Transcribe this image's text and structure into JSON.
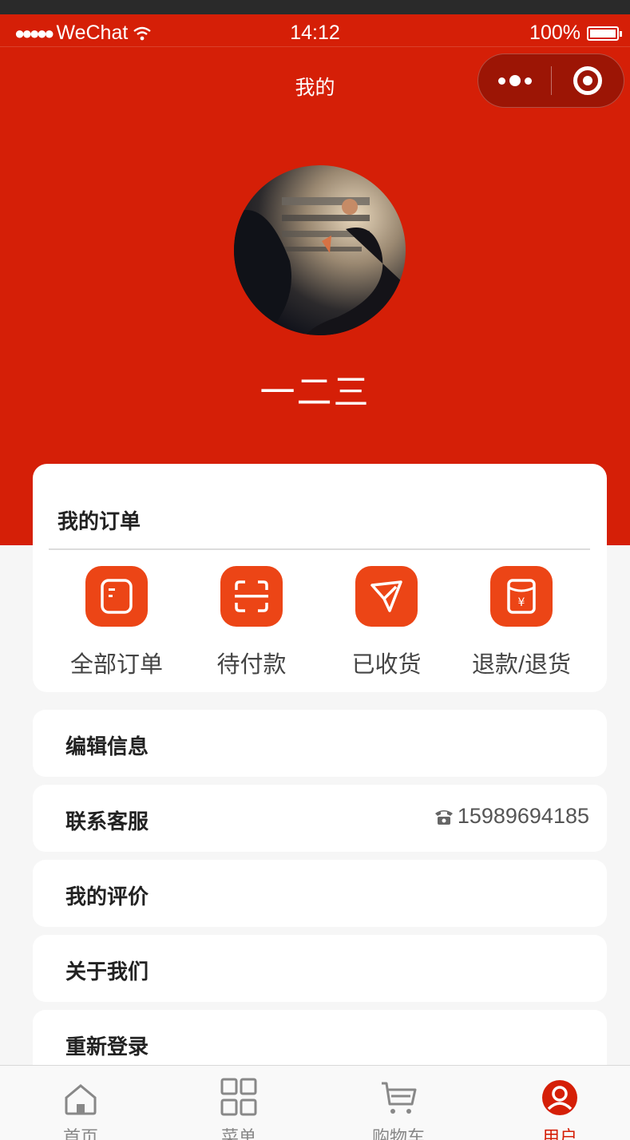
{
  "status_bar": {
    "signal": "●●●●●",
    "carrier": "WeChat",
    "time": "14:12",
    "battery": "100%"
  },
  "nav": {
    "title": "我的"
  },
  "profile": {
    "username": "一二三"
  },
  "orders": {
    "title": "我的订单",
    "items": [
      {
        "label": "全部订单",
        "icon": "document-icon"
      },
      {
        "label": "待付款",
        "icon": "scan-icon"
      },
      {
        "label": "已收货",
        "icon": "paper-plane-icon"
      },
      {
        "label": "退款/退货",
        "icon": "yen-envelope-icon"
      }
    ]
  },
  "menu": {
    "edit_info": "编辑信息",
    "contact_service": "联系客服",
    "contact_phone": "15989694185",
    "my_reviews": "我的评价",
    "about_us": "关于我们",
    "relogin": "重新登录"
  },
  "tabbar": {
    "items": [
      {
        "label": "首页",
        "icon": "home-icon"
      },
      {
        "label": "菜单",
        "icon": "grid-icon"
      },
      {
        "label": "购物车",
        "icon": "cart-icon"
      },
      {
        "label": "用户",
        "icon": "user-icon"
      }
    ],
    "active_index": 3
  },
  "colors": {
    "brand_red": "#d51f07",
    "icon_orange": "#ec4516",
    "background": "#f6f6f6"
  }
}
